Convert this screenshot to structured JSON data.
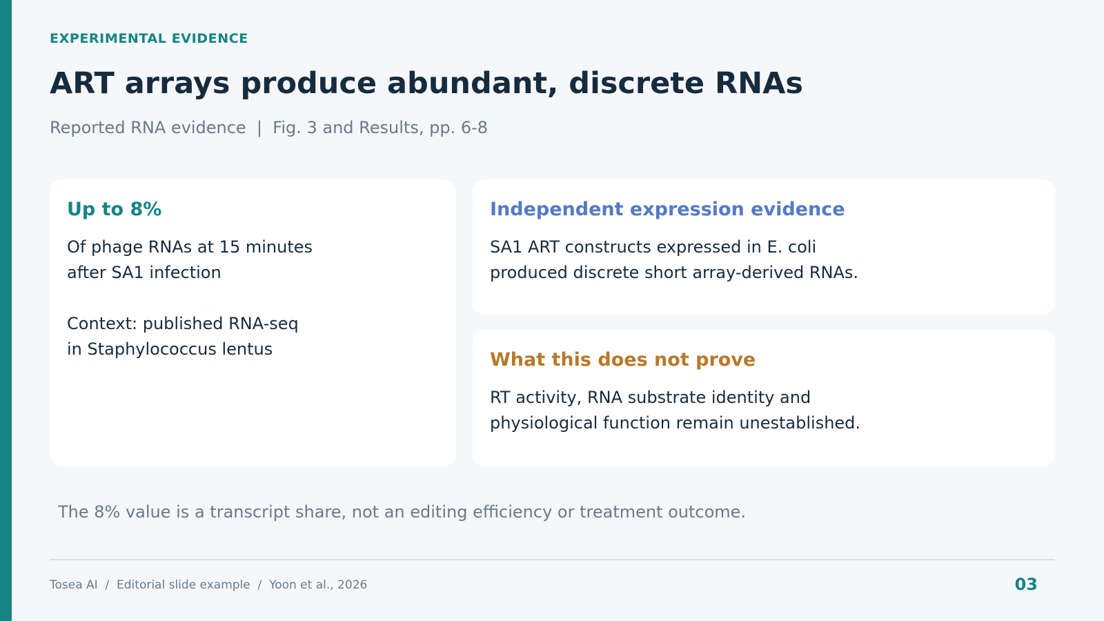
{
  "slide": {
    "eyebrow": "EXPERIMENTAL EVIDENCE",
    "title": "ART arrays produce abundant, discrete RNAs",
    "subtitle": "Reported RNA evidence  |  Fig. 3 and Results, pp. 6-8",
    "note": "The 8% value is a transcript share, not an editing efficiency or treatment outcome.",
    "footer": "Tosea AI  /  Editorial slide example  /  Yoon et al., 2026",
    "page_number": "03"
  },
  "cards": {
    "stat": {
      "heading": "Up to 8%",
      "body_line1": "Of phage RNAs at 15 minutes",
      "body_line2": "after SA1 infection",
      "context_line1": "Context: published RNA-seq",
      "context_line2": "in Staphylococcus lentus"
    },
    "expression": {
      "heading": "Independent expression evidence",
      "body_line1": "SA1 ART constructs expressed in E. coli",
      "body_line2": "produced discrete short array-derived RNAs."
    },
    "limits": {
      "heading": "What this does not prove",
      "body_line1": "RT activity, RNA substrate identity and",
      "body_line2": "physiological function remain unestablished."
    }
  },
  "colors": {
    "accent": "#168484",
    "blue_heading": "#5479ca",
    "amber_heading": "#b7792a",
    "text": "#172b3f",
    "muted": "#687a8c",
    "background": "#f5f7fa"
  }
}
